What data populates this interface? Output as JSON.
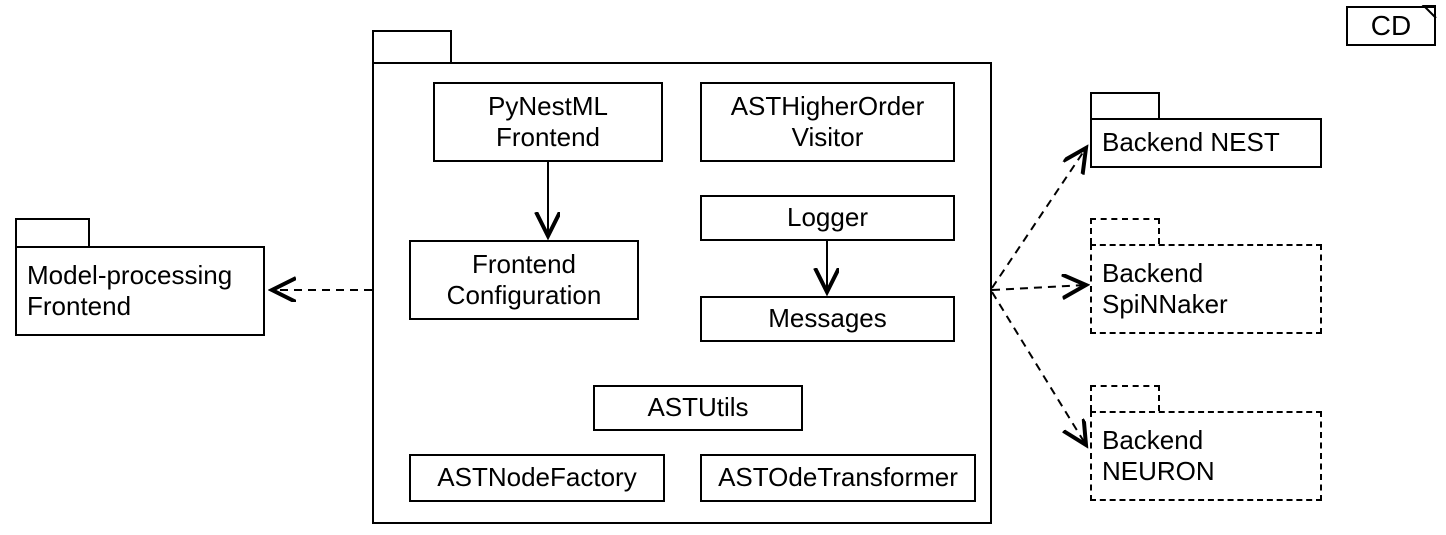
{
  "cd_label": "CD",
  "left_package": {
    "label": "Model-processing\nFrontend"
  },
  "center_package": {
    "classes": {
      "pynestml": "PyNestML\nFrontend",
      "frontend_config": "Frontend\nConfiguration",
      "higher_order": "ASTHigherOrder\nVisitor",
      "logger": "Logger",
      "messages": "Messages",
      "astutils": "ASTUtils",
      "node_factory": "ASTNodeFactory",
      "ode_transformer": "ASTOdeTransformer"
    }
  },
  "right_packages": {
    "nest": "Backend NEST",
    "spinnaker": "Backend\nSpiNNaker",
    "neuron": "Backend\nNEURON"
  }
}
